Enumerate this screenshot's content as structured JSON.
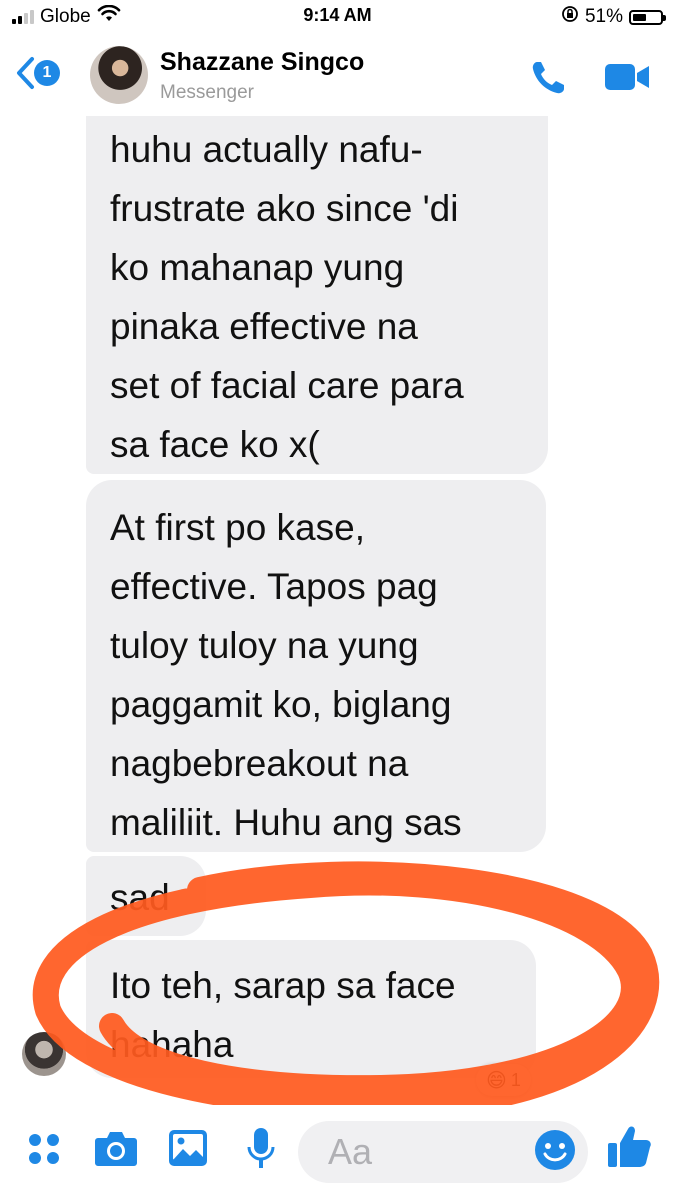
{
  "status_bar": {
    "carrier": "Globe",
    "time": "9:14 AM",
    "battery": "51%",
    "battery_level": 0.51,
    "icons": [
      "signal-icon",
      "wifi-icon",
      "orientation-lock-icon",
      "battery-icon"
    ]
  },
  "header": {
    "back_badge": "1",
    "contact_name": "Shazzane Singco",
    "subtitle": "Messenger",
    "actions": [
      "phone-icon",
      "video-camera-icon"
    ]
  },
  "messages": [
    {
      "text": "huhu actually nafu-\nfrustrate ako since 'di\nko mahanap yung\npinaka effective na\nset of facial care para\nsa face ko x("
    },
    {
      "text": "At first po kase,\neffective. Tapos pag\ntuloy tuloy na yung\npaggamit ko, biglang\nnagbebreakout na\nmaliliit. Huhu ang sas"
    },
    {
      "text": "sad"
    },
    {
      "text": "Ito teh, sarap sa face\nhahaha"
    }
  ],
  "reaction": {
    "emoji": "😄",
    "count": "1"
  },
  "composer": {
    "placeholder": "Aa",
    "icons": [
      "apps-grid-icon",
      "camera-icon",
      "photo-gallery-icon",
      "microphone-icon",
      "emoji-icon",
      "thumbs-up-icon"
    ]
  },
  "colors": {
    "accent": "#1e88e5",
    "bubble": "#eeeef0",
    "scribble": "#ff5a1f"
  }
}
